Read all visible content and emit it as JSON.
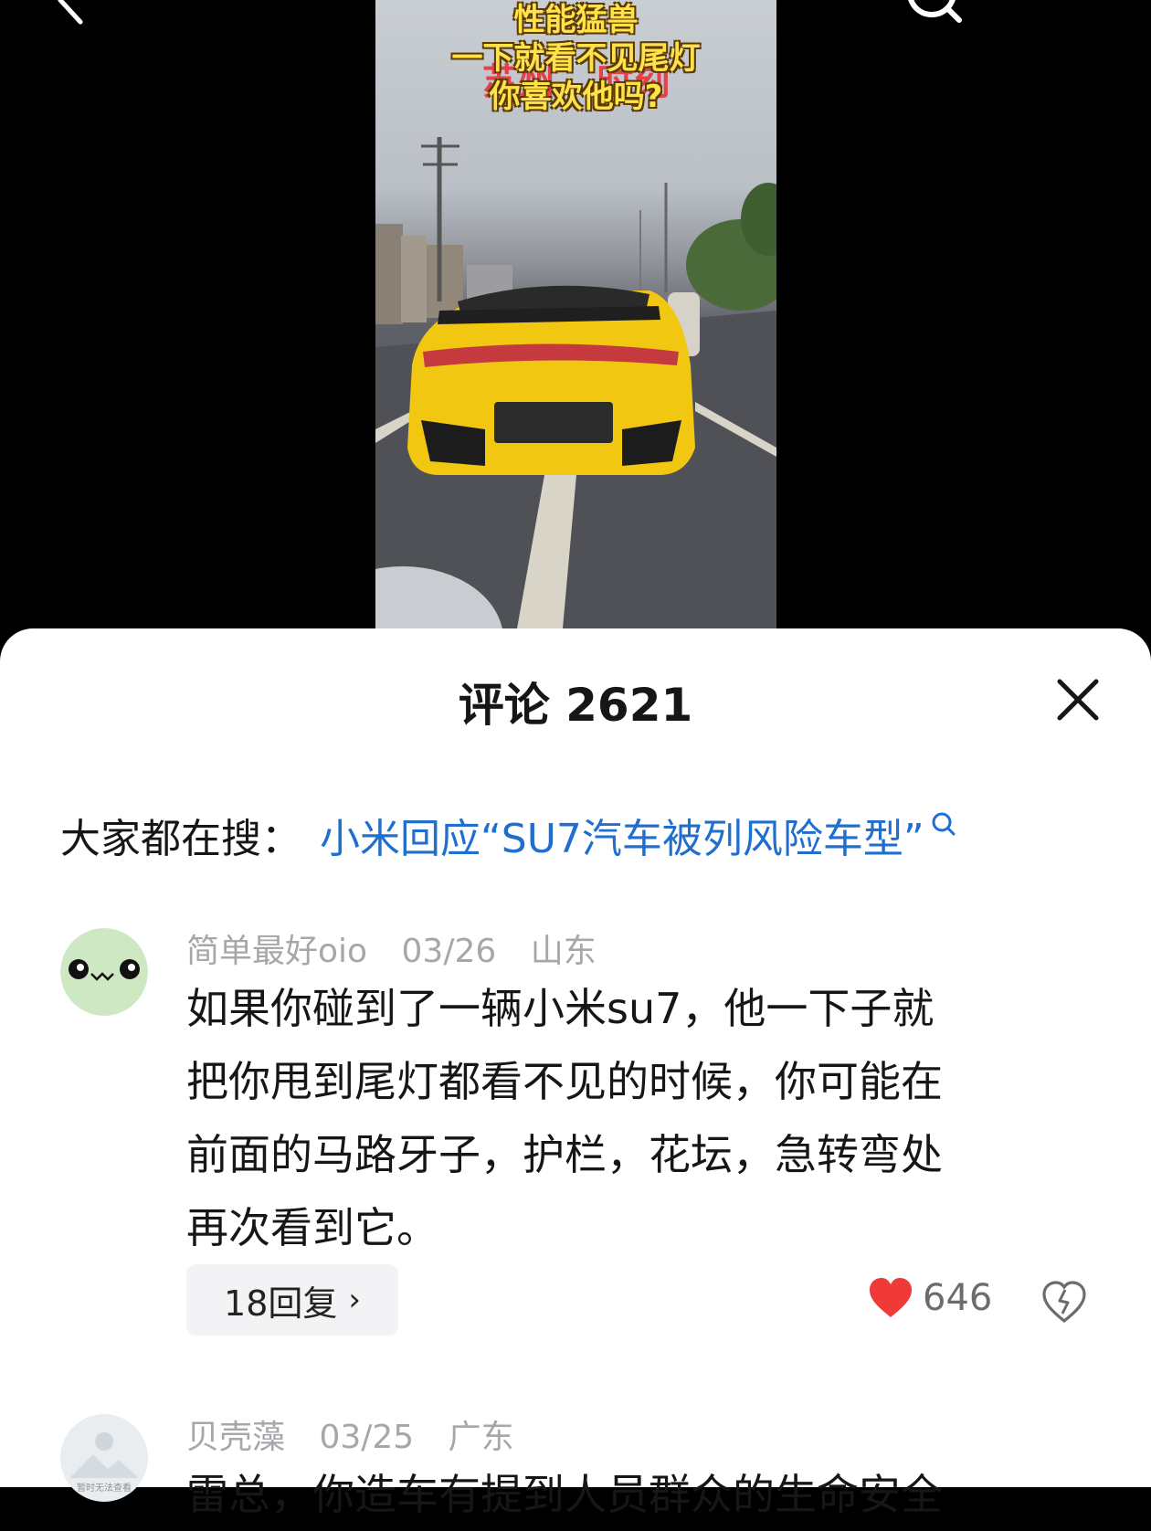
{
  "video": {
    "overlay_lines": [
      "性能猛兽",
      "一下就看不见尾灯",
      "你喜欢他吗?"
    ],
    "overlay_red": "苏州...时刻"
  },
  "panel": {
    "title": "评论 2621"
  },
  "hot_search": {
    "label": "大家都在搜：",
    "query": "小米回应“SU7汽车被列风险车型”"
  },
  "comments": [
    {
      "username": "简单最好oio",
      "date": "03/26",
      "location": "山东",
      "lines": [
        "如果你碰到了一辆小米su7，他一下子就",
        "把你甩到尾灯都看不见的时候，你可能在",
        "前面的马路牙子，护栏，花坛，急转弯处",
        "再次看到它。"
      ],
      "reply_label": "18回复",
      "like_count": "646",
      "liked": true
    },
    {
      "username": "贝壳藻",
      "date": "03/25",
      "location": "广东",
      "avatar_text": "暂时无法查看",
      "lines": [
        "雷总，你造车有提到人员群众的生命安全"
      ]
    }
  ],
  "colors": {
    "link": "#1e6fcf",
    "like_red": "#f03a3a",
    "meta_gray": "#a7a7ab",
    "overlay_yellow": "#ffe24a"
  }
}
